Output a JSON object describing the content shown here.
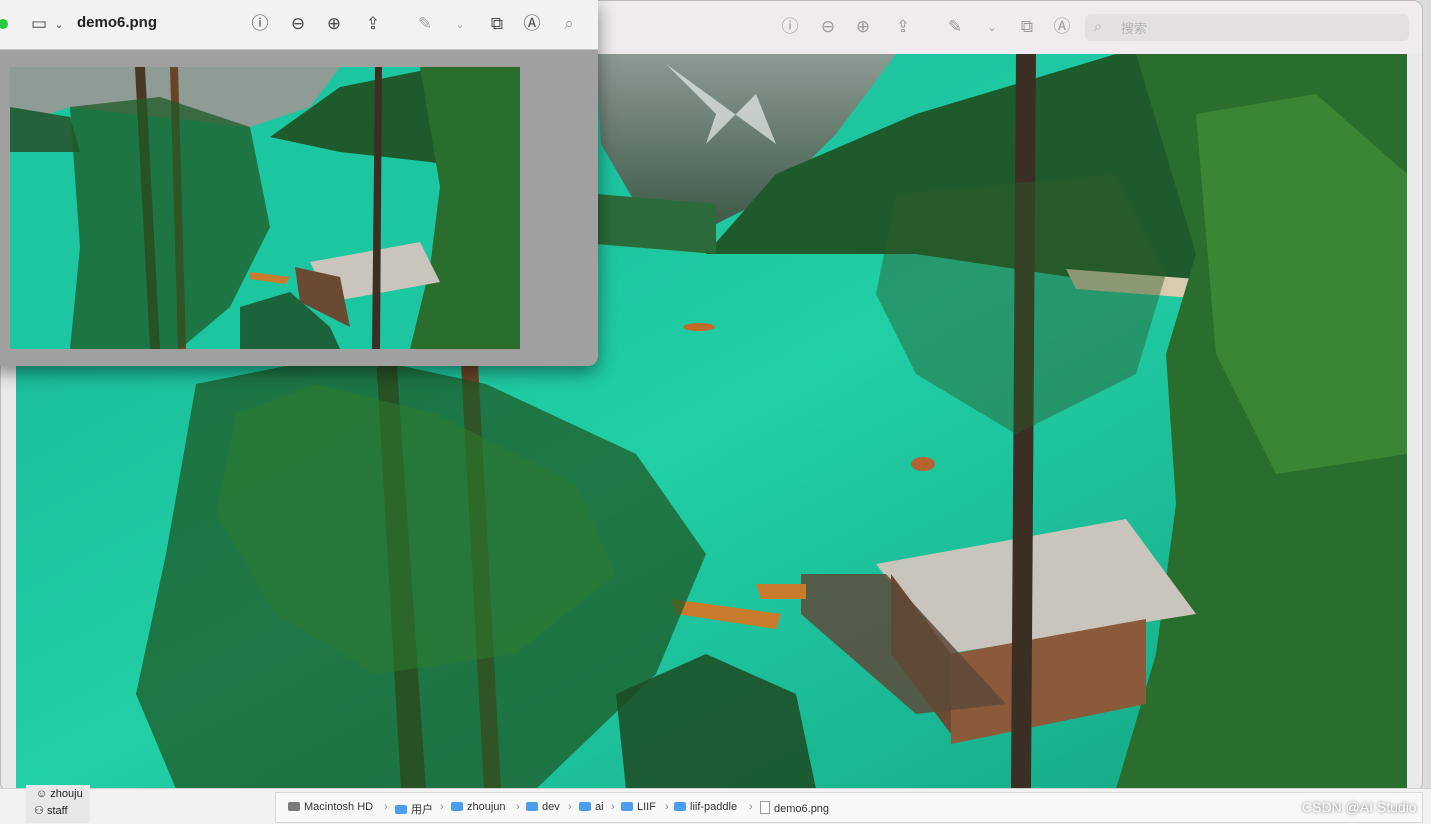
{
  "front_window": {
    "title": "demo6.png"
  },
  "back_window": {
    "search_placeholder": "搜索"
  },
  "finder": {
    "user_name": "zhouju",
    "user_group": "staff",
    "path": [
      "Macintosh HD",
      "用户",
      "zhoujun",
      "dev",
      "ai",
      "LIIF",
      "liif-paddle",
      "demo6.png"
    ]
  },
  "watermark": "CSDN @AI Studio",
  "colors": {
    "lake": "#1fc7a2",
    "forest": "#1f5a2c",
    "accent_folder": "#4a9ff0"
  }
}
